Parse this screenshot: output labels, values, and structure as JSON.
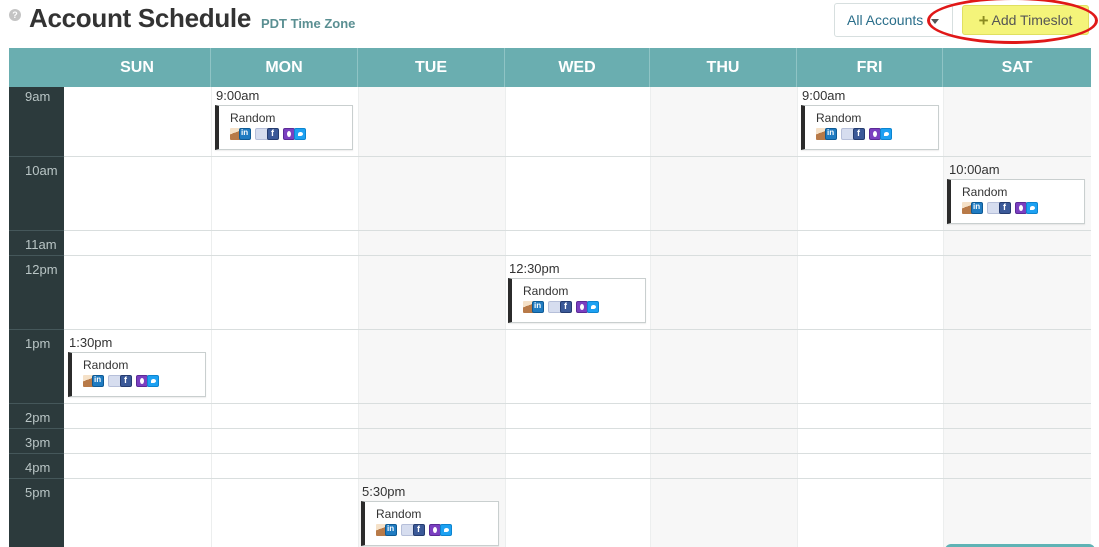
{
  "header": {
    "help_icon": "question-circle-icon",
    "title": "Account Schedule",
    "timezone": "PDT Time Zone",
    "accounts_dropdown": "All Accounts",
    "add_button": "Add Timeslot",
    "add_icon": "plus-icon"
  },
  "days": [
    "SUN",
    "MON",
    "TUE",
    "WED",
    "THU",
    "FRI",
    "SAT"
  ],
  "times": [
    "9am",
    "10am",
    "11am",
    "12pm",
    "1pm",
    "2pm",
    "3pm",
    "4pm",
    "5pm"
  ],
  "events": [
    {
      "day": "MON",
      "time": "9:00am",
      "name": "Random"
    },
    {
      "day": "FRI",
      "time": "9:00am",
      "name": "Random"
    },
    {
      "day": "SAT",
      "time": "10:00am",
      "name": "Random"
    },
    {
      "day": "WED",
      "time": "12:30pm",
      "name": "Random"
    },
    {
      "day": "SUN",
      "time": "1:30pm",
      "name": "Random"
    },
    {
      "day": "TUE",
      "time": "5:30pm",
      "name": "Random"
    }
  ],
  "event_icons": [
    "avatar-icon",
    "linkedin-icon",
    "page-icon",
    "facebook-icon",
    "instagram-icon",
    "twitter-icon"
  ],
  "colors": {
    "header_teal": "#6aaeb0",
    "time_column": "#2c3a3c",
    "add_button": "#f4f47a",
    "highlight": "#e01818"
  }
}
